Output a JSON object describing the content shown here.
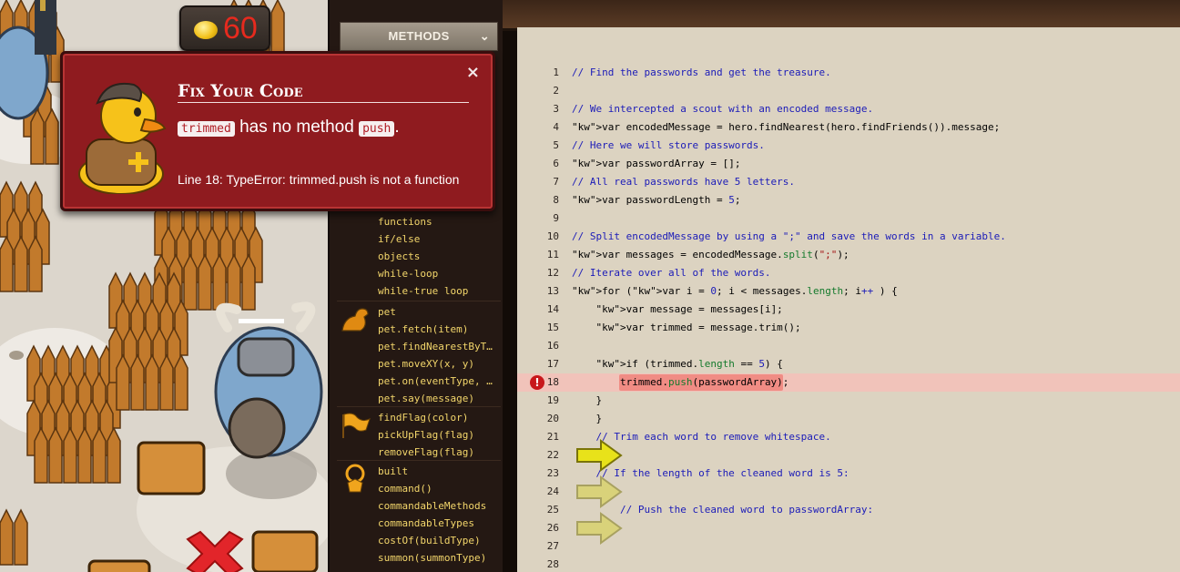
{
  "hud": {
    "gold": "60"
  },
  "palette": {
    "header": "METHODS",
    "groups": [
      {
        "icon": "hero-icon",
        "items": [
          "functions",
          "if/else",
          "objects",
          "while-loop",
          "while-true loop"
        ]
      },
      {
        "icon": "pet-icon",
        "items": [
          "pet",
          "pet.fetch(item)",
          "pet.findNearestByT…",
          "pet.moveXY(x, y)",
          "pet.on(eventType, …",
          "pet.say(message)"
        ]
      },
      {
        "icon": "flag-icon",
        "items": [
          "findFlag(color)",
          "pickUpFlag(flag)",
          "removeFlag(flag)"
        ]
      },
      {
        "icon": "boss-star-icon",
        "items": [
          "built",
          "command()",
          "commandableMethods",
          "commandableTypes",
          "costOf(buildType)",
          "summon(summonType)"
        ]
      }
    ]
  },
  "popup": {
    "title": "Fix Your Code",
    "object_name": "trimmed",
    "msg_mid": "has no method",
    "method_name": "push",
    "msg_end": ".",
    "detail": "Line 18: TypeError: trimmed.push is not a function",
    "close": "×"
  },
  "code": {
    "error_line": 18,
    "lines": [
      "// Find the passwords and get the treasure.",
      "",
      "// We intercepted a scout with an encoded message.",
      "var encodedMessage = hero.findNearest(hero.findFriends()).message;",
      "// Here we will store passwords.",
      "var passwordArray = [];",
      "// All real passwords have 5 letters.",
      "var passwordLength = 5;",
      "",
      "// Split encodedMessage by using a \";\" and save the words in a variable.",
      "var messages = encodedMessage.split(\";\");",
      "// Iterate over all of the words.",
      "for (var i = 0; i < messages.length; i++ ) {",
      "    var message = messages[i];",
      "    var trimmed = message.trim();",
      "",
      "    if (trimmed.length == 5) {",
      "        trimmed.push(passwordArray);",
      "    }",
      "    }",
      "    // Trim each word to remove whitespace.",
      "",
      "    // If the length of the cleaned word is 5:",
      "",
      "        // Push the cleaned word to passwordArray:",
      "",
      "",
      ""
    ]
  },
  "colors": {
    "popup_bg": "#8f1b1f",
    "error_line_bg": "#f1c3ba",
    "palette_text": "#f3d66b",
    "comment": "#1b1bb8",
    "property": "#157a2c"
  }
}
